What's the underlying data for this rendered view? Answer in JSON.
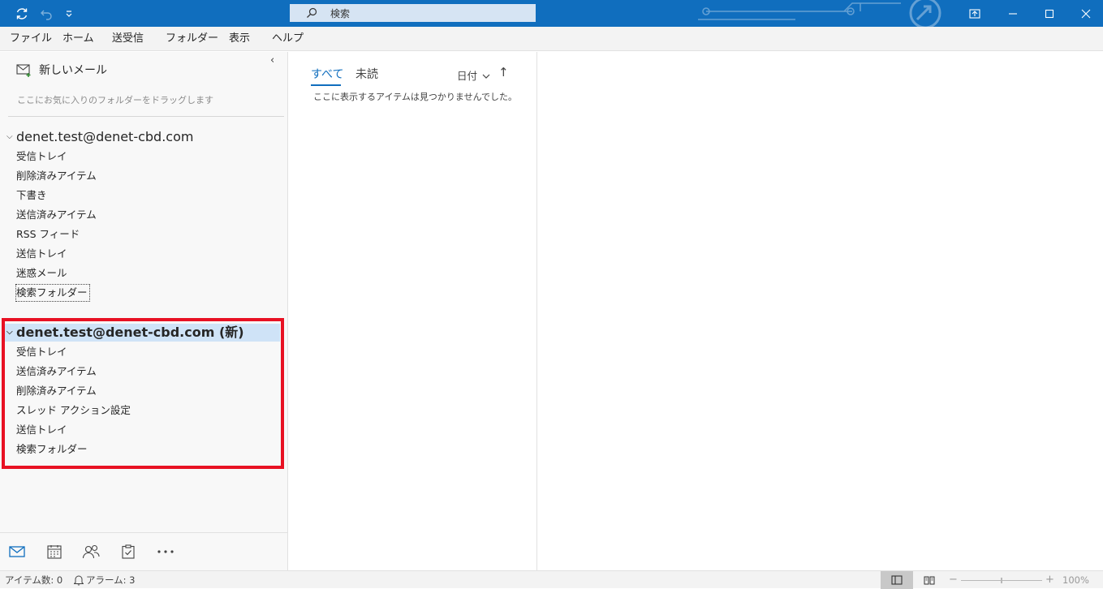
{
  "titlebar": {
    "search_placeholder": "検索",
    "accent": "#106ebe"
  },
  "menu": {
    "items": [
      "ファイル",
      "ホーム",
      "送受信",
      "フォルダー",
      "表示",
      "ヘルプ"
    ]
  },
  "folder_pane": {
    "new_mail": "新しいメール",
    "favorites_hint": "ここにお気に入りのフォルダーをドラッグします",
    "accounts": [
      {
        "name": "denet.test@denet-cbd.com",
        "folders": [
          "受信トレイ",
          "削除済みアイテム",
          "下書き",
          "送信済みアイテム",
          "RSS フィード",
          "送信トレイ",
          "迷惑メール",
          "検索フォルダー"
        ]
      },
      {
        "name": "denet.test@denet-cbd.com (新)",
        "folders": [
          "受信トレイ",
          "送信済みアイテム",
          "削除済みアイテム",
          "スレッド アクション設定",
          "送信トレイ",
          "検索フォルダー"
        ]
      }
    ],
    "highlight_color": "#e81123"
  },
  "message_list": {
    "tab_all": "すべて",
    "tab_unread": "未読",
    "sort_label": "日付",
    "sort_arrow": "↑",
    "empty_text": "ここに表示するアイテムは見つかりませんでした。"
  },
  "statusbar": {
    "items_count": "アイテム数: 0",
    "alarms": "アラーム: 3",
    "zoom": "100%"
  }
}
